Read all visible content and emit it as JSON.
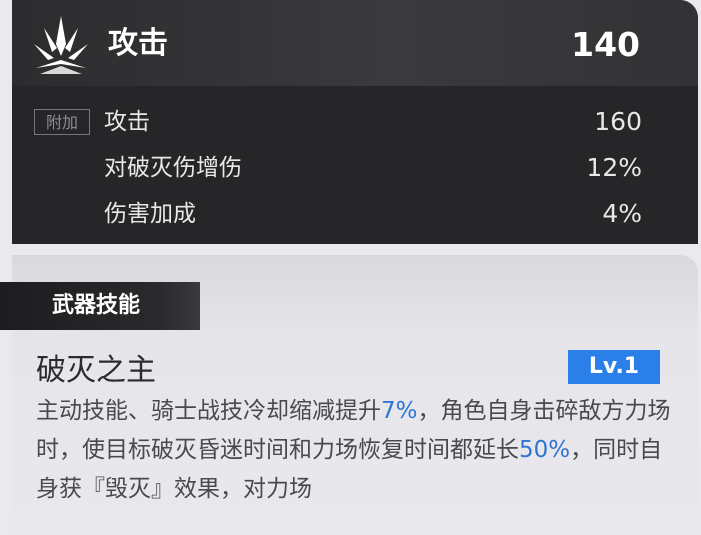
{
  "main_stat": {
    "icon": "weapon-sigil-icon",
    "label": "攻击",
    "value": "140"
  },
  "extra_tag": "附加",
  "sub_stats": [
    {
      "label": "攻击",
      "value": "160"
    },
    {
      "label": "对破灭伤增伤",
      "value": "12%"
    },
    {
      "label": "伤害加成",
      "value": "4%"
    }
  ],
  "skill": {
    "section_title": "武器技能",
    "name": "破灭之主",
    "level": "Lv.1",
    "desc": {
      "p1": "主动技能、骑士战技冷却缩减提升",
      "hl1": "7%",
      "p2": "，角色自身击碎敌方力场时，使目标破灭昏迷时间和力场恢复时间都延长",
      "hl2": "50%",
      "p3": "，同时自身获『毁灭』效果，对力场"
    }
  },
  "colors": {
    "highlight": "#2e74d6",
    "level_badge": "#2b7fe8",
    "panel_dark": "#2d2d2f"
  }
}
